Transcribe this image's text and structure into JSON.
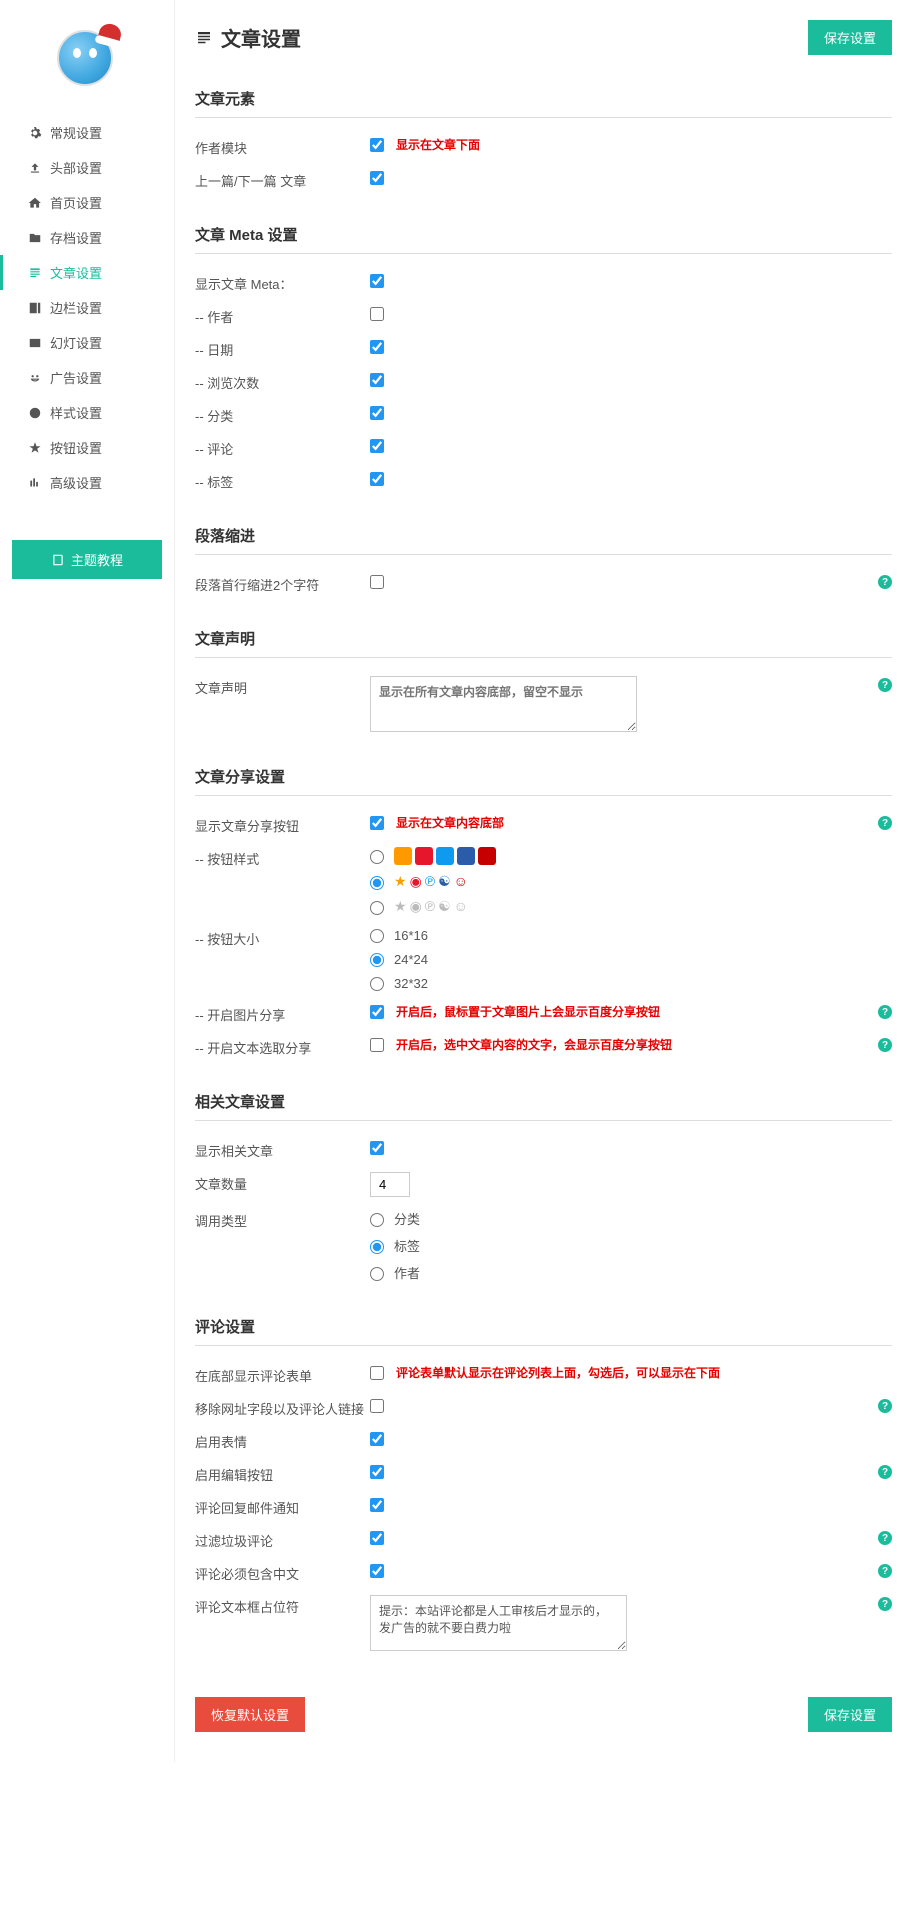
{
  "page": {
    "title": "文章设置",
    "saveLabel": "保存设置",
    "resetLabel": "恢复默认设置"
  },
  "sidebar": {
    "tutorialLabel": "主题教程",
    "items": [
      {
        "label": "常规设置"
      },
      {
        "label": "头部设置"
      },
      {
        "label": "首页设置"
      },
      {
        "label": "存档设置"
      },
      {
        "label": "文章设置"
      },
      {
        "label": "边栏设置"
      },
      {
        "label": "幻灯设置"
      },
      {
        "label": "广告设置"
      },
      {
        "label": "样式设置"
      },
      {
        "label": "按钮设置"
      },
      {
        "label": "高级设置"
      }
    ]
  },
  "sections": {
    "elements": {
      "title": "文章元素",
      "author": {
        "label": "作者模块",
        "hint": "显示在文章下面"
      },
      "prevNext": {
        "label": "上一篇/下一篇 文章"
      }
    },
    "meta": {
      "title": "文章 Meta 设置",
      "show": "显示文章 Meta：",
      "author": "-- 作者",
      "date": "-- 日期",
      "views": "-- 浏览次数",
      "category": "-- 分类",
      "comments": "-- 评论",
      "tags": "-- 标签"
    },
    "indent": {
      "title": "段落缩进",
      "label": "段落首行缩进2个字符"
    },
    "statement": {
      "title": "文章声明",
      "label": "文章声明",
      "placeholder": "显示在所有文章内容底部，留空不显示"
    },
    "share": {
      "title": "文章分享设置",
      "showBtn": {
        "label": "显示文章分享按钮",
        "hint": "显示在文章内容底部"
      },
      "btnStyle": "-- 按钮样式",
      "btnSize": {
        "label": "-- 按钮大小",
        "s1": "16*16",
        "s2": "24*24",
        "s3": "32*32"
      },
      "imgShare": {
        "label": "-- 开启图片分享",
        "hint": "开启后，鼠标置于文章图片上会显示百度分享按钮"
      },
      "textShare": {
        "label": "-- 开启文本选取分享",
        "hint": "开启后，选中文章内容的文字，会显示百度分享按钮"
      }
    },
    "related": {
      "title": "相关文章设置",
      "show": "显示相关文章",
      "count": {
        "label": "文章数量",
        "value": "4"
      },
      "type": {
        "label": "调用类型",
        "cat": "分类",
        "tag": "标签",
        "author": "作者"
      }
    },
    "comment": {
      "title": "评论设置",
      "formPos": {
        "label": "在底部显示评论表单",
        "hint": "评论表单默认显示在评论列表上面，勾选后，可以显示在下面"
      },
      "removeUrl": "移除网址字段以及评论人链接",
      "emoji": "启用表情",
      "editBtn": "启用编辑按钮",
      "emailNotify": "评论回复邮件通知",
      "spam": "过滤垃圾评论",
      "chinese": "评论必须包含中文",
      "placeholder": {
        "label": "评论文本框占位符",
        "value": "提示：本站评论都是人工审核后才显示的，发广告的就不要白费力啦"
      }
    }
  }
}
